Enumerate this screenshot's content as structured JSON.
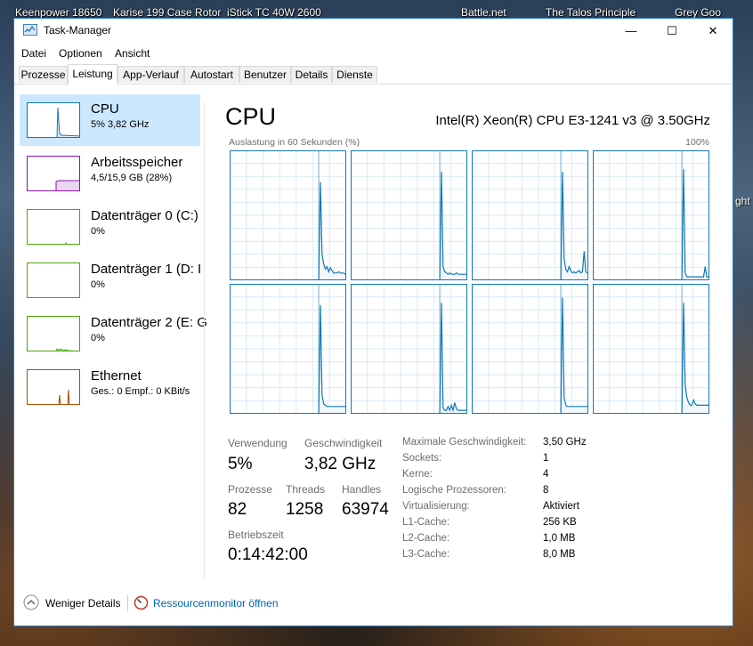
{
  "desktop": {
    "icons": [
      "Keenpower 18650",
      "Karise 199 Case Rotor",
      "iStick TC 40W 2600",
      "Battle.net",
      "The Talos Principle",
      "Grey Goo"
    ],
    "side_text": "ght"
  },
  "window": {
    "title": "Task-Manager",
    "controls": {
      "minimize": "—",
      "maximize": "☐",
      "close": "✕"
    }
  },
  "menu": [
    "Datei",
    "Optionen",
    "Ansicht"
  ],
  "tabs": [
    "Prozesse",
    "Leistung",
    "App-Verlauf",
    "Autostart",
    "Benutzer",
    "Details",
    "Dienste"
  ],
  "active_tab": "Leistung",
  "sidebar": {
    "items": [
      {
        "title": "CPU",
        "subtitle": "5% 3,82 GHz",
        "color": "#1178b7"
      },
      {
        "title": "Arbeitsspeicher",
        "subtitle": "4,5/15,9 GB (28%)",
        "color": "#8b12ae"
      },
      {
        "title": "Datenträger 0 (C:)",
        "subtitle": "0%",
        "color": "#4da60c"
      },
      {
        "title": "Datenträger 1 (D: I",
        "subtitle": "0%",
        "color": "#4da60c"
      },
      {
        "title": "Datenträger 2 (E: G",
        "subtitle": "0%",
        "color": "#4da60c"
      },
      {
        "title": "Ethernet",
        "subtitle": "Ges.: 0 Empf.: 0 KBit/s",
        "color": "#a74f01"
      }
    ]
  },
  "cpu": {
    "heading": "CPU",
    "model": "Intel(R) Xeon(R) CPU E3-1241 v3 @ 3.50GHz",
    "graph_caption": "Auslastung in 60 Sekunden (%)",
    "graph_max": "100%",
    "graph_color": "#1178b7",
    "stats": {
      "usage_label": "Verwendung",
      "usage_value": "5%",
      "speed_label": "Geschwindigkeit",
      "speed_value": "3,82 GHz",
      "processes_label": "Prozesse",
      "processes_value": "82",
      "threads_label": "Threads",
      "threads_value": "1258",
      "handles_label": "Handles",
      "handles_value": "63974",
      "uptime_label": "Betriebszeit",
      "uptime_value": "0:14:42:00"
    },
    "info": [
      {
        "label": "Maximale Geschwindigkeit:",
        "value": "3,50 GHz"
      },
      {
        "label": "Sockets:",
        "value": "1"
      },
      {
        "label": "Kerne:",
        "value": "4"
      },
      {
        "label": "Logische Prozessoren:",
        "value": "8"
      },
      {
        "label": "Virtualisierung:",
        "value": "Aktiviert"
      },
      {
        "label": "L1-Cache:",
        "value": "256 KB"
      },
      {
        "label": "L2-Cache:",
        "value": "1,0 MB"
      },
      {
        "label": "L3-Cache:",
        "value": "8,0 MB"
      }
    ]
  },
  "footer": {
    "fewer_details": "Weniger Details",
    "resource_monitor": "Ressourcenmonitor öffnen"
  },
  "chart_data": {
    "type": "line",
    "x_range": [
      0,
      60
    ],
    "ylim": [
      0,
      100
    ],
    "grid": true,
    "series": [
      {
        "values": [
          0,
          0,
          0,
          0,
          0,
          0,
          0,
          0,
          0,
          0,
          0,
          0,
          0,
          0,
          0,
          0,
          0,
          0,
          0,
          0,
          0,
          0,
          0,
          0,
          0,
          0,
          0,
          0,
          0,
          0,
          0,
          0,
          0,
          0,
          0,
          0,
          0,
          0,
          0,
          0,
          0,
          0,
          0,
          0,
          0,
          0,
          0,
          0,
          0,
          0,
          0,
          0,
          0,
          0,
          76,
          20,
          12,
          8,
          10,
          6,
          9,
          7,
          5,
          5,
          5,
          6,
          5,
          5,
          5,
          4
        ]
      },
      {
        "values": [
          0,
          0,
          0,
          0,
          0,
          0,
          0,
          0,
          0,
          0,
          0,
          0,
          0,
          0,
          0,
          0,
          0,
          0,
          0,
          0,
          0,
          0,
          0,
          0,
          0,
          0,
          0,
          0,
          0,
          0,
          0,
          0,
          0,
          0,
          0,
          0,
          0,
          0,
          0,
          0,
          0,
          0,
          0,
          0,
          0,
          0,
          0,
          0,
          0,
          0,
          0,
          0,
          0,
          0,
          84,
          10,
          6,
          5,
          4,
          5,
          4,
          4,
          4,
          5,
          4,
          4,
          4,
          4,
          4,
          4
        ]
      },
      {
        "values": [
          0,
          0,
          0,
          0,
          0,
          0,
          0,
          0,
          0,
          0,
          0,
          0,
          0,
          0,
          0,
          0,
          0,
          0,
          0,
          0,
          0,
          0,
          0,
          0,
          0,
          0,
          0,
          0,
          0,
          0,
          0,
          0,
          0,
          0,
          0,
          0,
          0,
          0,
          0,
          0,
          0,
          0,
          0,
          0,
          0,
          0,
          0,
          0,
          0,
          0,
          0,
          0,
          0,
          0,
          84,
          16,
          8,
          6,
          10,
          7,
          5,
          6,
          5,
          6,
          7,
          5,
          6,
          22,
          6,
          5
        ]
      },
      {
        "values": [
          0,
          0,
          0,
          0,
          0,
          0,
          0,
          0,
          0,
          0,
          0,
          0,
          0,
          0,
          0,
          0,
          0,
          0,
          0,
          0,
          0,
          0,
          0,
          0,
          0,
          0,
          0,
          0,
          0,
          0,
          0,
          0,
          0,
          0,
          0,
          0,
          0,
          0,
          0,
          0,
          0,
          0,
          0,
          0,
          0,
          0,
          0,
          0,
          0,
          0,
          0,
          0,
          0,
          0,
          86,
          5,
          2,
          2,
          2,
          2,
          2,
          2,
          2,
          2,
          2,
          2,
          2,
          10,
          2,
          2
        ]
      },
      {
        "values": [
          0,
          0,
          0,
          0,
          0,
          0,
          0,
          0,
          0,
          0,
          0,
          0,
          0,
          0,
          0,
          0,
          0,
          0,
          0,
          0,
          0,
          0,
          0,
          0,
          0,
          0,
          0,
          0,
          0,
          0,
          0,
          0,
          0,
          0,
          0,
          0,
          0,
          0,
          0,
          0,
          0,
          0,
          0,
          0,
          0,
          0,
          0,
          0,
          0,
          0,
          0,
          0,
          0,
          0,
          84,
          14,
          7,
          6,
          5,
          5,
          5,
          5,
          5,
          5,
          5,
          5,
          5,
          5,
          5,
          5
        ]
      },
      {
        "values": [
          0,
          0,
          0,
          0,
          0,
          0,
          0,
          0,
          0,
          0,
          0,
          0,
          0,
          0,
          0,
          0,
          0,
          0,
          0,
          0,
          0,
          0,
          0,
          0,
          0,
          0,
          0,
          0,
          0,
          0,
          0,
          0,
          0,
          0,
          0,
          0,
          0,
          0,
          0,
          0,
          0,
          0,
          0,
          0,
          0,
          0,
          0,
          0,
          0,
          0,
          0,
          0,
          0,
          0,
          86,
          4,
          2,
          2,
          5,
          2,
          6,
          2,
          8,
          3,
          2,
          2,
          2,
          2,
          2,
          2
        ]
      },
      {
        "values": [
          0,
          0,
          0,
          0,
          0,
          0,
          0,
          0,
          0,
          0,
          0,
          0,
          0,
          0,
          0,
          0,
          0,
          0,
          0,
          0,
          0,
          0,
          0,
          0,
          0,
          0,
          0,
          0,
          0,
          0,
          0,
          0,
          0,
          0,
          0,
          0,
          0,
          0,
          0,
          0,
          0,
          0,
          0,
          0,
          0,
          0,
          0,
          0,
          0,
          0,
          0,
          0,
          0,
          0,
          90,
          12,
          6,
          5,
          5,
          5,
          5,
          5,
          5,
          5,
          5,
          5,
          5,
          5,
          5,
          5
        ]
      },
      {
        "values": [
          0,
          0,
          0,
          0,
          0,
          0,
          0,
          0,
          0,
          0,
          0,
          0,
          0,
          0,
          0,
          0,
          0,
          0,
          0,
          0,
          0,
          0,
          0,
          0,
          0,
          0,
          0,
          0,
          0,
          0,
          0,
          0,
          0,
          0,
          0,
          0,
          0,
          0,
          0,
          0,
          0,
          0,
          0,
          0,
          0,
          0,
          0,
          0,
          0,
          0,
          0,
          0,
          0,
          0,
          86,
          22,
          12,
          8,
          6,
          6,
          10,
          7,
          6,
          6,
          6,
          6,
          6,
          6,
          6,
          6
        ]
      }
    ]
  }
}
